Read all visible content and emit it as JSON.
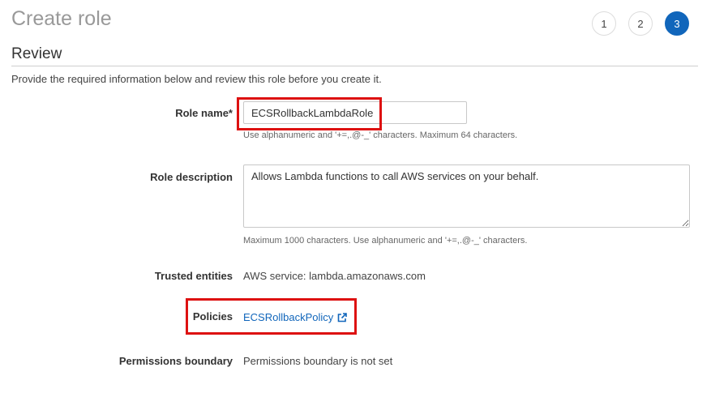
{
  "header": {
    "title": "Create role"
  },
  "steps": [
    {
      "label": "1",
      "active": false
    },
    {
      "label": "2",
      "active": false
    },
    {
      "label": "3",
      "active": true
    }
  ],
  "section": {
    "title": "Review",
    "intro": "Provide the required information below and review this role before you create it."
  },
  "form": {
    "role_name": {
      "label": "Role name*",
      "value": "ECSRollbackLambdaRole",
      "hint": "Use alphanumeric and '+=,.@-_' characters. Maximum 64 characters."
    },
    "role_description": {
      "label": "Role description",
      "value": "Allows Lambda functions to call AWS services on your behalf.",
      "hint": "Maximum 1000 characters. Use alphanumeric and '+=,.@-_' characters."
    },
    "trusted_entities": {
      "label": "Trusted entities",
      "value": "AWS service: lambda.amazonaws.com"
    },
    "policies": {
      "label": "Policies",
      "link_text": "ECSRollbackPolicy",
      "icon": "external-link-icon"
    },
    "permissions_boundary": {
      "label": "Permissions boundary",
      "value": "Permissions boundary is not set"
    }
  },
  "colors": {
    "accent": "#1166bb",
    "highlight": "#dd1111"
  }
}
